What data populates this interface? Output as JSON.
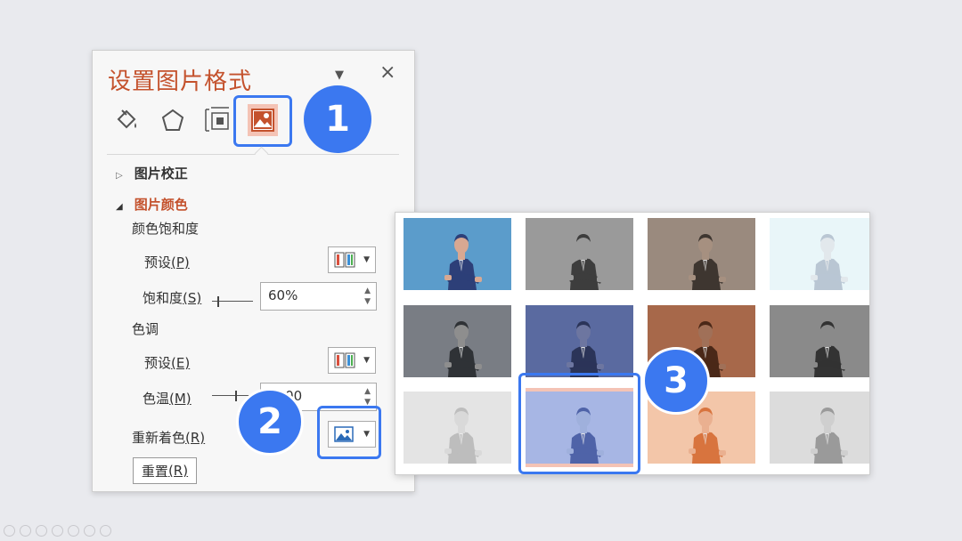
{
  "panel": {
    "title": "设置图片格式",
    "menu_icon": "chevron-down-icon",
    "close_icon": "close-icon",
    "close_label": "×",
    "tabs": [
      {
        "name": "fill-line",
        "icon": "paint-bucket-icon"
      },
      {
        "name": "effects",
        "icon": "pentagon-icon"
      },
      {
        "name": "size-properties",
        "icon": "size-properties-icon"
      },
      {
        "name": "picture",
        "icon": "picture-icon",
        "selected": true
      }
    ],
    "sections": {
      "correction": {
        "label": "图片校正",
        "expanded": false
      },
      "color": {
        "label": "图片颜色",
        "expanded": true
      }
    },
    "saturation": {
      "header": "颜色饱和度",
      "preset_label": "预设",
      "preset_key": "(P)",
      "level_label": "饱和度",
      "level_key": "(S)",
      "value": "60%"
    },
    "tone": {
      "header": "色调",
      "preset_label": "预设",
      "preset_key": "(E)",
      "temp_label": "色温",
      "temp_key": "(M)",
      "value": "6500"
    },
    "recolor": {
      "label": "重新着色",
      "key": "(R)"
    },
    "reset": {
      "label": "重置",
      "key": "(R)"
    }
  },
  "callouts": [
    "1",
    "2",
    "3"
  ],
  "gallery": {
    "thumbnails": [
      {
        "name": "original",
        "bg": "#5b9ccb",
        "suit": "#2d3f78",
        "skin": "#d8a892",
        "opacity": 1
      },
      {
        "name": "grayscale",
        "bg": "#9a9a9a",
        "suit": "#3d3d3d",
        "skin": "#9a9a9a",
        "opacity": 1
      },
      {
        "name": "sepia",
        "bg": "#9a8a7e",
        "suit": "#3e3630",
        "skin": "#a69080",
        "opacity": 1
      },
      {
        "name": "washout",
        "bg": "#e9f6f9",
        "suit": "#b9c6d3",
        "skin": "#e2e8ec",
        "opacity": 1
      },
      {
        "name": "dark-gray",
        "bg": "#797d84",
        "suit": "#2f3236",
        "skin": "#8e8e8e",
        "opacity": 1
      },
      {
        "name": "dark-blue",
        "bg": "#5a6aa0",
        "suit": "#2b3458",
        "skin": "#6d76a0",
        "opacity": 1
      },
      {
        "name": "dark-orange",
        "bg": "#a7684a",
        "suit": "#4a2818",
        "skin": "#a07058",
        "opacity": 1
      },
      {
        "name": "gray-dark-2",
        "bg": "#8a8a8a",
        "suit": "#333333",
        "skin": "#8a8a8a",
        "opacity": 1
      },
      {
        "name": "light-gray",
        "bg": "#e4e4e4",
        "suit": "#bdbdbd",
        "skin": "#d9d9d9",
        "opacity": 1
      },
      {
        "name": "light-blue",
        "bg": "#a7b6e4",
        "suit": "#4f63a8",
        "skin": "#9fb0dc",
        "opacity": 1
      },
      {
        "name": "light-orange",
        "bg": "#f3c6a9",
        "suit": "#d8743e",
        "skin": "#eab090",
        "opacity": 1
      },
      {
        "name": "light-gray-2",
        "bg": "#dcdcdc",
        "suit": "#9a9a9a",
        "skin": "#cfcfcf",
        "opacity": 1
      }
    ],
    "selected_index": 9,
    "selected_color": "#f4c3b5"
  },
  "accent": "#3b78f0",
  "title_color": "#c4522d"
}
